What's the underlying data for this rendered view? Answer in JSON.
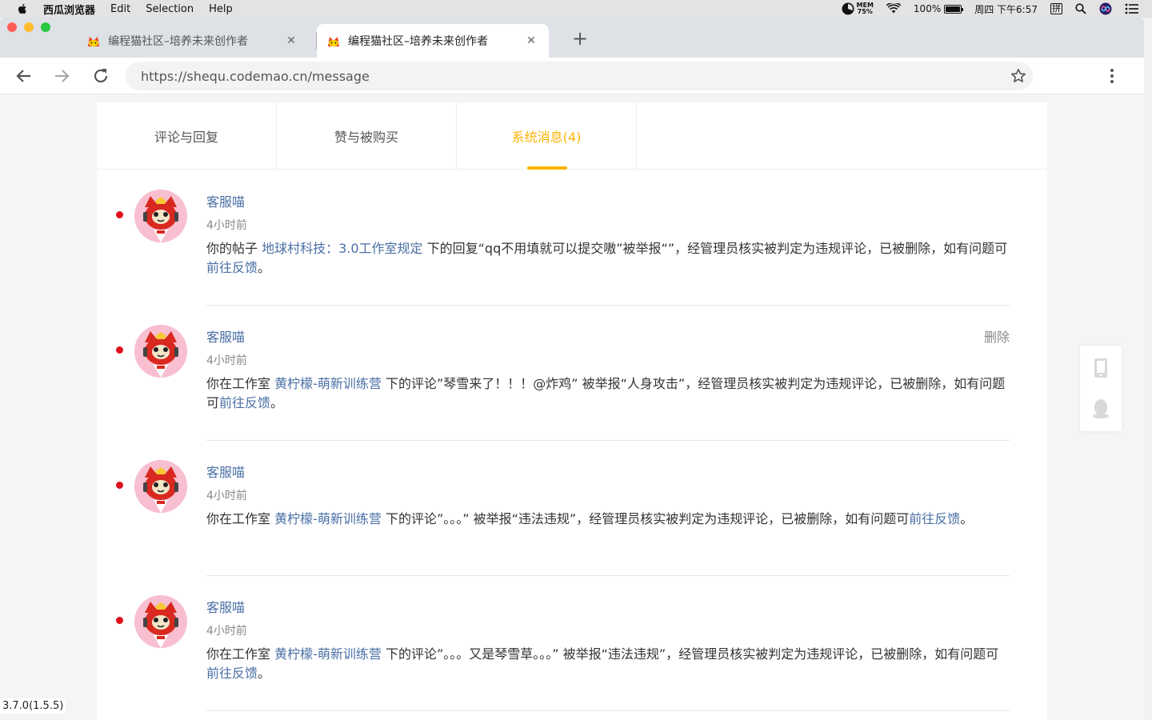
{
  "menubar": {
    "app_name": "西瓜浏览器",
    "items": [
      "Edit",
      "Selection",
      "Help"
    ],
    "mem_label": "MEM",
    "mem_value": "75%",
    "battery": "100%",
    "battery_level": 1.0,
    "datetime": "周四 下午6:57",
    "input_method": "拼"
  },
  "tabs": [
    {
      "title": "编程猫社区–培养未来创作者",
      "active": false
    },
    {
      "title": "编程猫社区–培养未来创作者",
      "active": true
    }
  ],
  "address": {
    "url": "https://shequ.codemao.cn/message"
  },
  "message_tabs": [
    {
      "label": "评论与回复"
    },
    {
      "label": "赞与被购买"
    },
    {
      "label": "系统消息(4)"
    }
  ],
  "messages": [
    {
      "sender": "客服喵",
      "time": "4小时前",
      "delete_label": "",
      "pre": "你的帖子 ",
      "link1": "地球村科技：3.0工作室规定",
      "mid": " 下的回复“qq不用填就可以提交嗷”被举报“”，经管理员核实被判定为违规评论，已被删除，如有问题可",
      "link2": "前往反馈",
      "post": "。"
    },
    {
      "sender": "客服喵",
      "time": "4小时前",
      "delete_label": "删除",
      "pre": "你在工作室 ",
      "link1": "黄柠檬-萌新训练营",
      "mid": " 下的评论”琴雪来了！！！@炸鸡” 被举报“人身攻击”，经管理员核实被判定为违规评论，已被删除，如有问题可",
      "link2": "前往反馈",
      "post": "。"
    },
    {
      "sender": "客服喵",
      "time": "4小时前",
      "delete_label": "",
      "pre": "你在工作室 ",
      "link1": "黄柠檬-萌新训练营",
      "mid": " 下的评论”。。。” 被举报“违法违规”，经管理员核实被判定为违规评论，已被删除，如有问题可",
      "link2": "前往反馈",
      "post": "。"
    },
    {
      "sender": "客服喵",
      "time": "4小时前",
      "delete_label": "",
      "pre": "你在工作室 ",
      "link1": "黄柠檬-萌新训练营",
      "mid": " 下的评论”。。。又是琴雪草。。。” 被举报“违法违规”，经管理员核实被判定为违规评论，已被删除，如有问题可",
      "link2": "前往反馈",
      "post": "。"
    }
  ],
  "version": "3.7.0(1.5.5)",
  "colors": {
    "accent": "#fdb300",
    "link": "#4a6fa5",
    "unread_dot": "#e0101d"
  }
}
